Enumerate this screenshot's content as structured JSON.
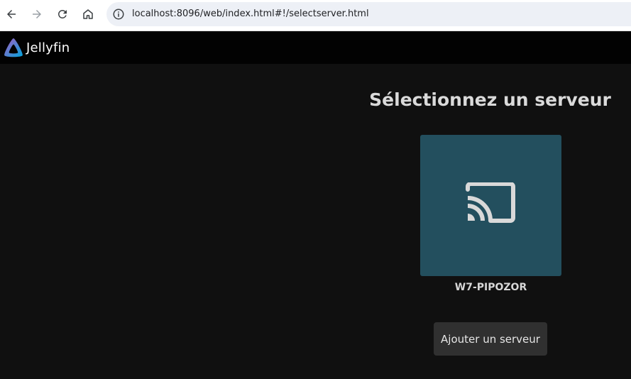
{
  "browser": {
    "url": "localhost:8096/web/index.html#!/selectserver.html"
  },
  "app": {
    "name": "Jellyfin"
  },
  "main": {
    "title": "Sélectionnez un serveur",
    "servers": [
      {
        "name": "W7-PIPOZOR",
        "icon": "cast-icon"
      }
    ],
    "add_server_label": "Ajouter un serveur"
  },
  "colors": {
    "card": "#234f5e",
    "background": "#101010",
    "header": "#020202",
    "button": "#303030"
  }
}
